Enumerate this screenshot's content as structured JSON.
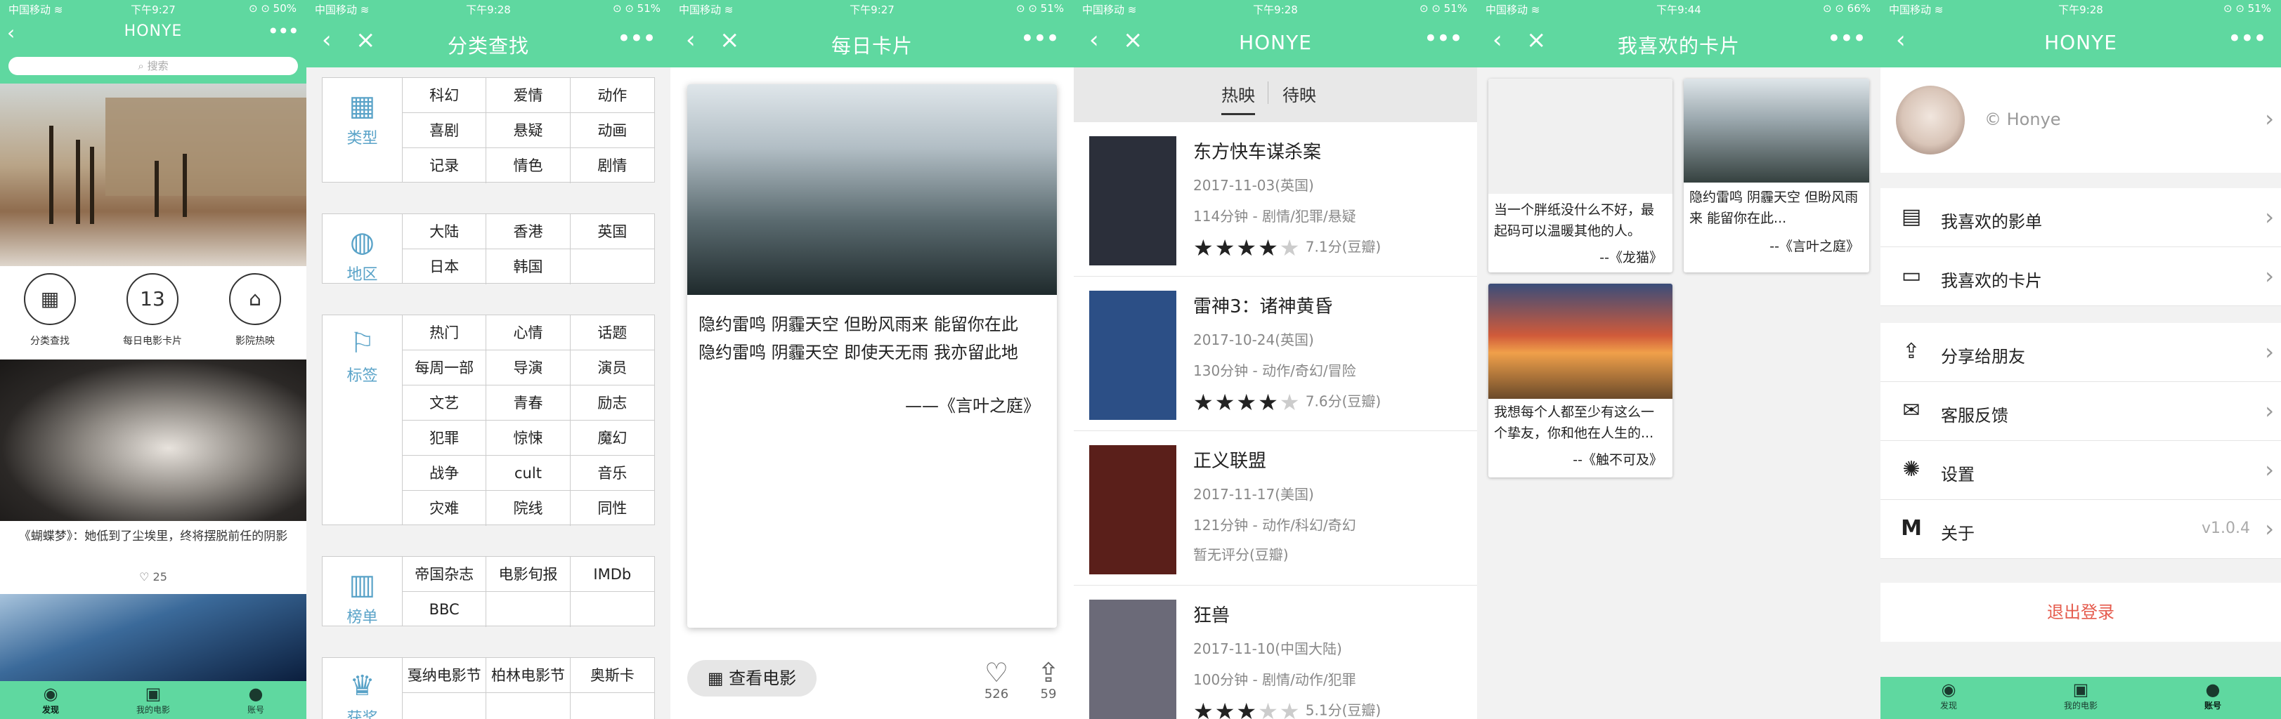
{
  "colors": {
    "accent": "#5fd8a0",
    "category": "#5aa3c8",
    "logout": "#e55b4d"
  },
  "p1": {
    "status": {
      "left": "中国移动 ≋",
      "time": "下午9:27",
      "right": "⊙ ⊙ 50%"
    },
    "title": "HONYE",
    "search_placeholder": "搜索",
    "icons": [
      {
        "label": "分类查找",
        "icon": "grid-icon"
      },
      {
        "label": "每日电影卡片",
        "text": "13"
      },
      {
        "label": "影院热映",
        "icon": "cinema-icon"
      }
    ],
    "caption": "《蝴蝶梦》：她低到了尘埃里，终将摆脱前任的阴影",
    "likes": "25",
    "tabs": [
      "发现",
      "我的电影",
      "账号"
    ]
  },
  "p2": {
    "status": {
      "left": "中国移动 ≋",
      "time": "下午9:28",
      "right": "⊙ ⊙ 51%"
    },
    "title": "分类查找",
    "categories": [
      {
        "name": "类型",
        "icon": "grid-icon",
        "items": [
          "科幻",
          "爱情",
          "动作",
          "喜剧",
          "悬疑",
          "动画",
          "记录",
          "情色",
          "剧情"
        ]
      },
      {
        "name": "地区",
        "icon": "globe-icon",
        "items": [
          "大陆",
          "香港",
          "英国",
          "日本",
          "韩国",
          ""
        ]
      },
      {
        "name": "标签",
        "icon": "bookmark-icon",
        "items": [
          "热门",
          "心情",
          "话题",
          "每周一部",
          "导演",
          "演员",
          "文艺",
          "青春",
          "励志",
          "犯罪",
          "惊悚",
          "魔幻",
          "战争",
          "cult",
          "音乐",
          "灾难",
          "院线",
          "同性"
        ]
      },
      {
        "name": "榜单",
        "icon": "bar-chart-icon",
        "items": [
          "帝国杂志",
          "电影旬报",
          "IMDb",
          "BBC",
          "",
          ""
        ]
      },
      {
        "name": "获奖",
        "icon": "trophy-icon",
        "items": [
          "戛纳电影节",
          "柏林电影节",
          "奥斯卡",
          "",
          "",
          ""
        ]
      }
    ]
  },
  "p3": {
    "status": {
      "left": "中国移动 ≋",
      "time": "下午9:27",
      "right": "⊙ ⊙ 51%"
    },
    "title": "每日卡片",
    "text": "隐约雷鸣 阴霾天空 但盼风雨来 能留你在此\n隐约雷鸣 阴霾天空 即使天无雨 我亦留此地",
    "source": "——《言叶之庭》",
    "watch_button": "查看电影",
    "likes": "526",
    "shares": "59"
  },
  "p4": {
    "status": {
      "left": "中国移动 ≋",
      "time": "下午9:28",
      "right": "⊙ ⊙ 51%"
    },
    "title": "HONYE",
    "segments": [
      "热映",
      "待映"
    ],
    "movies": [
      {
        "title": "东方快车谋杀案",
        "date": "2017-11-03(英国)",
        "info": "114分钟 - 剧情/犯罪/悬疑",
        "rating": "7.1分(豆瓣)",
        "stars": 3.5,
        "poster": "#2b2f3a"
      },
      {
        "title": "雷神3：诸神黄昏",
        "date": "2017-10-24(英国)",
        "info": "130分钟 - 动作/奇幻/冒险",
        "rating": "7.6分(豆瓣)",
        "stars": 4,
        "poster": "#2c4f86"
      },
      {
        "title": "正义联盟",
        "date": "2017-11-17(美国)",
        "info": "121分钟 - 动作/科幻/奇幻",
        "rating": "暂无评分(豆瓣)",
        "stars": 0,
        "poster": "#5a1f1a"
      },
      {
        "title": "狂兽",
        "date": "2017-11-10(中国大陆)",
        "info": "100分钟 - 剧情/动作/犯罪",
        "rating": "5.1分(豆瓣)",
        "stars": 2.5,
        "poster": "#6b6a78"
      }
    ]
  },
  "p5": {
    "status": {
      "left": "中国移动 ≋",
      "time": "下午9:44",
      "right": "⊙ ⊙ 66%"
    },
    "title": "我喜欢的卡片",
    "cards": [
      {
        "text": "当一个胖纸没什么不好，最起码可以温暖其他的人。",
        "source": "--《龙猫》"
      },
      {
        "text": "隐约雷鸣 阴霾天空 但盼风雨来 能留你在此...",
        "source": "--《言叶之庭》"
      },
      {
        "text": "我想每个人都至少有这么一个挚友，你和他在人生的...",
        "source": "--《触不可及》"
      }
    ]
  },
  "p6": {
    "status": {
      "left": "中国移动 ≋",
      "time": "下午9:28",
      "right": "⊙ ⊙ 51%"
    },
    "title": "HONYE",
    "username": "© Honye",
    "menu": [
      {
        "label": "我喜欢的影单",
        "icon": "film-list-icon"
      },
      {
        "label": "我喜欢的卡片",
        "icon": "card-icon"
      },
      {
        "label": "分享给朋友",
        "icon": "share-icon"
      },
      {
        "label": "客服反馈",
        "icon": "mail-icon"
      },
      {
        "label": "设置",
        "icon": "gear-icon"
      },
      {
        "label": "关于",
        "icon": "m-logo-icon",
        "value": "v1.0.4"
      }
    ],
    "logout": "退出登录",
    "tabs": [
      "发现",
      "我的电影",
      "账号"
    ]
  }
}
